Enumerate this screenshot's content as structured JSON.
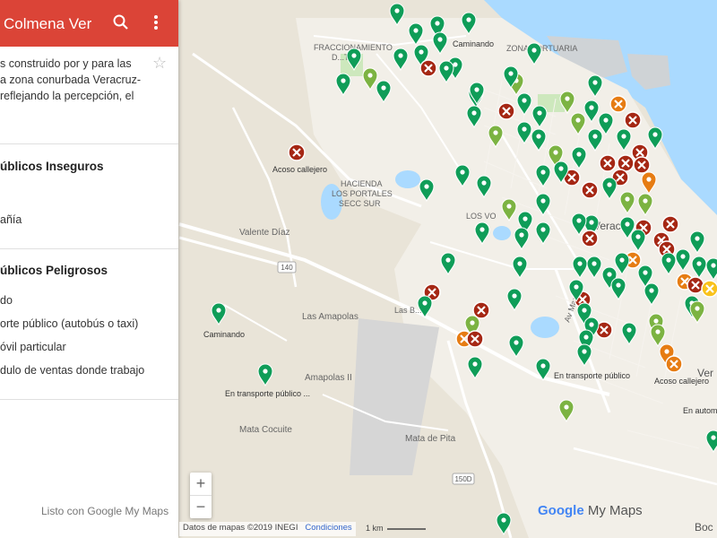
{
  "sidebar": {
    "title": "Colmena Ver",
    "description_lines": [
      "s construido por y para las",
      "a zona conurbada Veracruz-",
      "reflejando la percepción, el"
    ],
    "layers": [
      {
        "title": "úblicos Inseguros",
        "items": [
          "",
          "añía"
        ]
      },
      {
        "title": "úblicos Peligrosos",
        "items": [
          "do",
          "orte público (autobús o taxi)",
          "óvil particular",
          "dulo de ventas donde trabajo"
        ]
      }
    ],
    "footer": "Listo con Google My Maps"
  },
  "map": {
    "labels": {
      "fracc_line1": "FRACCIONAMIENTO",
      "fracc_line2": "D...TE",
      "caminando_top": "Caminando",
      "zona_portuaria": "ZONA PORTUARIA",
      "hacienda_1": "HACIENDA",
      "hacienda_2": "LOS PORTALES",
      "hacienda_3": "SECC SUR",
      "acoso_left": "Acoso callejero",
      "valente": "Valente Díaz",
      "las_amapolas": "Las Amapolas",
      "amapolas_ii": "Amapolas II",
      "caminando_left": "Caminando",
      "en_transporte_left": "En transporte público ...",
      "en_transporte_mid": "En transporte público",
      "mata_cocuite": "Mata Cocuite",
      "mata_pita": "Mata de Pita",
      "acoso_right": "Acoso callejero",
      "en_autom": "En autom",
      "veracruz_frag": "Veracr",
      "ver_frag": "Ver",
      "boc_frag": "Boc",
      "los_vo": "LOS VO",
      "av_mirador": "Av Mar...",
      "road_140": "140",
      "road_150d": "150D",
      "las_br": "Las B..."
    },
    "marker_colors": {
      "green": "#0f9d58",
      "light_green": "#7cb342",
      "dark_red": "#a52714",
      "orange": "#e67c13",
      "yellow": "#f9c21b"
    },
    "zoom_in": "+",
    "zoom_out": "−",
    "attribution": "Datos de mapas ©2019 INEGI",
    "conditions": "Condiciones",
    "scale": "1 km",
    "brand": "Google",
    "brand_suffix": " My Maps"
  }
}
